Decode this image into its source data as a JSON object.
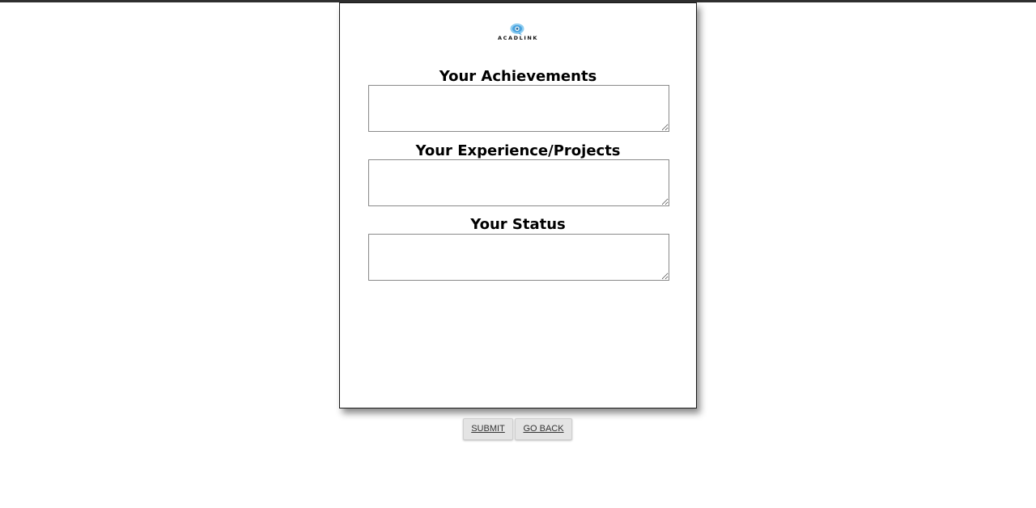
{
  "brand": {
    "logo_text": "ACADLINK",
    "logo_icon": "chat-bubble-icon",
    "logo_color": "#4aa3df"
  },
  "form": {
    "achievements": {
      "label": "Your Achievements",
      "value": ""
    },
    "experience": {
      "label": "Your Experience/Projects",
      "value": ""
    },
    "status": {
      "label": "Your Status",
      "value": ""
    }
  },
  "actions": {
    "submit_label": "SUBMIT",
    "back_label": "GO BACK"
  },
  "colors": {
    "page_background": "#ffffff",
    "top_strip": "#2f2f2f",
    "button_background": "#e4e4e4"
  }
}
